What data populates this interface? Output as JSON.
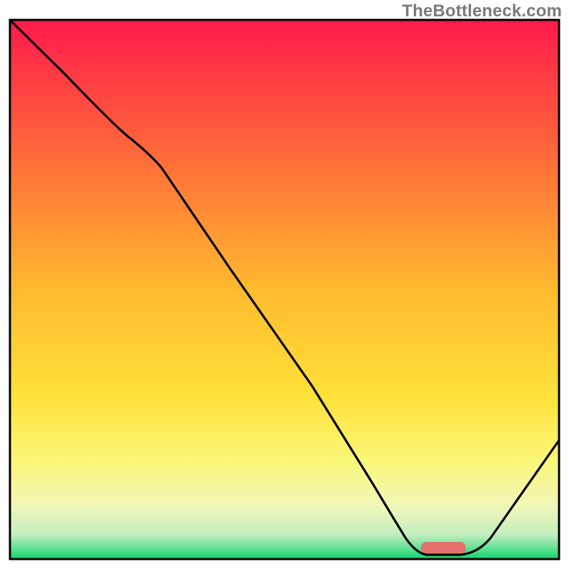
{
  "watermark": "TheBottleneck.com",
  "icon_names": {
    "watermark": "watermark-text"
  },
  "chart_data": {
    "type": "line",
    "title": "",
    "xlabel": "",
    "ylabel": "",
    "xlim": [
      0,
      100
    ],
    "ylim": [
      0,
      100
    ],
    "grid": false,
    "legend": false,
    "axes_visible": false,
    "description": "Bottleneck % vs configuration axis; heat-gradient background from red (high bottleneck) through orange/yellow to green (0%).",
    "gradient_stops": [
      {
        "pos": 0.0,
        "color": "#ff1a4b"
      },
      {
        "pos": 0.25,
        "color": "#ff6a3a"
      },
      {
        "pos": 0.5,
        "color": "#ffba2e"
      },
      {
        "pos": 0.7,
        "color": "#ffe23a"
      },
      {
        "pos": 0.82,
        "color": "#faf77a"
      },
      {
        "pos": 0.9,
        "color": "#f1f7b8"
      },
      {
        "pos": 0.955,
        "color": "#c3eec0"
      },
      {
        "pos": 1.0,
        "color": "#12d66f"
      }
    ],
    "series": [
      {
        "name": "bottleneck-curve",
        "color": "#000000",
        "x": [
          0,
          10,
          22,
          28,
          40,
          55,
          66,
          72,
          78,
          82,
          88,
          100
        ],
        "y": [
          100,
          90,
          78,
          72,
          54,
          32,
          14,
          4,
          0,
          0,
          4,
          22
        ]
      }
    ],
    "optimum_marker": {
      "x_start": 75,
      "x_end": 83,
      "y": 0,
      "color": "#e4716e",
      "shape": "rounded-bar"
    }
  }
}
